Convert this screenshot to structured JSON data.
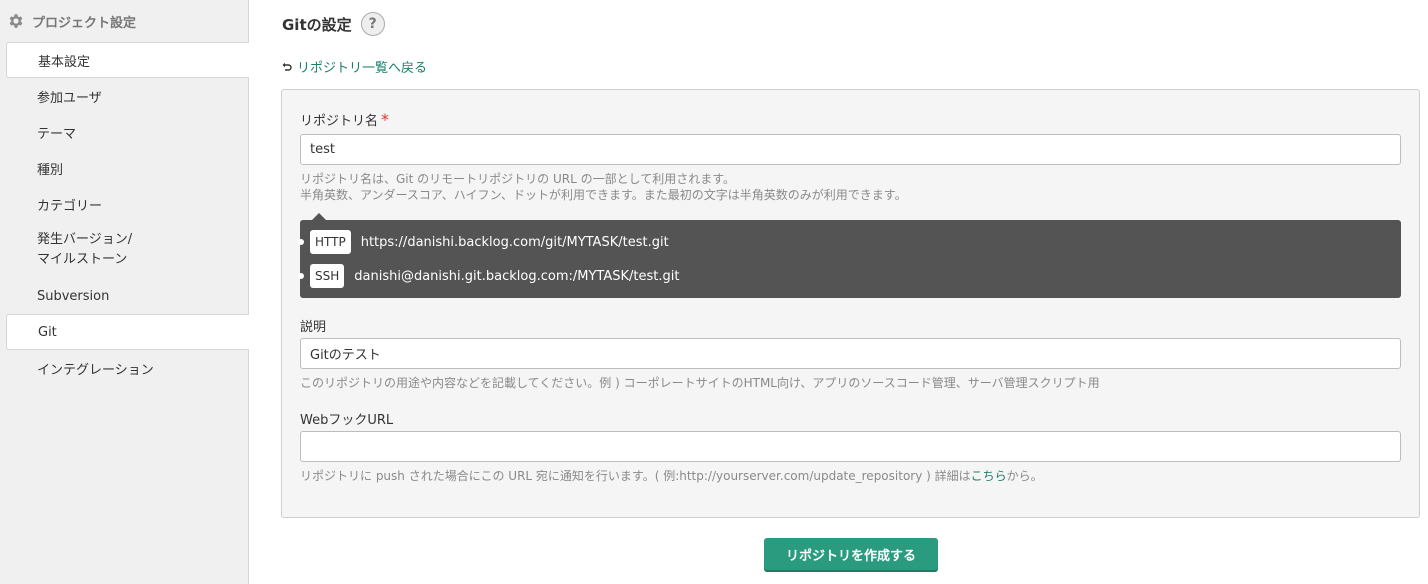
{
  "sidebar": {
    "header": "プロジェクト設定",
    "items": [
      {
        "label": "基本設定"
      },
      {
        "label": "参加ユーザ"
      },
      {
        "label": "テーマ"
      },
      {
        "label": "種別"
      },
      {
        "label": "カテゴリー"
      },
      {
        "label_line1": "発生バージョン/",
        "label_line2": "マイルストーン"
      },
      {
        "label": "Subversion"
      },
      {
        "label": "Git"
      },
      {
        "label": "インテグレーション"
      }
    ]
  },
  "main": {
    "title": "Gitの設定",
    "help_label": "?",
    "back_link": "リポジトリ一覧へ戻る",
    "repo_name": {
      "label": "リポジトリ名",
      "required_mark": "*",
      "value": "test",
      "help_line1": "リポジトリ名は、Git のリモートリポジトリの URL の一部として利用されます。",
      "help_line2": "半角英数、アンダースコア、ハイフン、ドットが利用できます。また最初の文字は半角英数のみが利用できます。"
    },
    "urls": {
      "http_label": "HTTP",
      "http_url": "https://danishi.backlog.com/git/MYTASK/test.git",
      "ssh_label": "SSH",
      "ssh_url": "danishi@danishi.git.backlog.com:/MYTASK/test.git"
    },
    "description": {
      "label": "説明",
      "value": "Gitのテスト",
      "help": "このリポジトリの用途や内容などを記載してください。例 ) コーポレートサイトのHTML向け、アプリのソースコード管理、サーバ管理スクリプト用"
    },
    "webhook": {
      "label": "WebフックURL",
      "value": "",
      "help_prefix": "リポジトリに push された場合にこの URL 宛に通知を行います。( 例:http://yourserver.com/update_repository ) 詳細は",
      "help_link": "こちら",
      "help_suffix": "から。"
    },
    "submit_label": "リポジトリを作成する"
  },
  "colors": {
    "accent": "#2a9b7f",
    "link": "#18806c",
    "url_box": "#545454",
    "required": "#e0362c"
  }
}
